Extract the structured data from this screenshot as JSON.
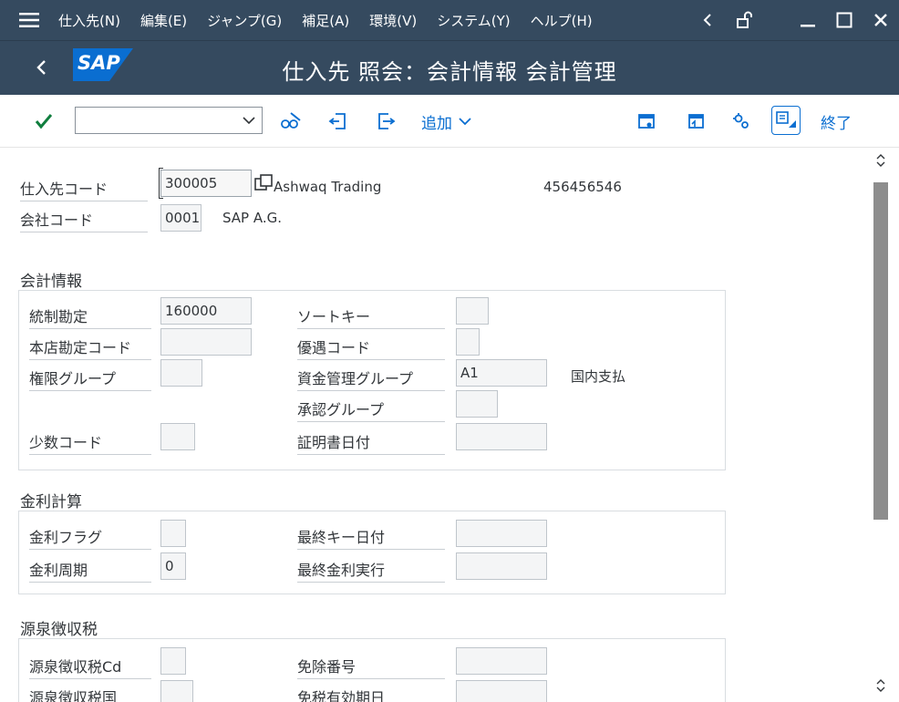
{
  "menubar": {
    "items": [
      "仕入先(N)",
      "編集(E)",
      "ジャンプ(G)",
      "補足(A)",
      "環境(V)",
      "システム(Y)",
      "ヘルプ(H)"
    ]
  },
  "titlebar": {
    "logo_text": "SAP",
    "title": "仕入先 照会：会計情報 会計管理"
  },
  "toolbar": {
    "command_placeholder": "",
    "add_label": "追加",
    "exit_label": "終了"
  },
  "header": {
    "vendor_label": "仕入先コード",
    "vendor_value": "300005",
    "vendor_name": "Ashwaq Trading",
    "vendor_number": "456456546",
    "company_label": "会社コード",
    "company_value": "0001",
    "company_name": "SAP A.G."
  },
  "accounting": {
    "title": "会計情報",
    "recon_label": "統制勘定",
    "recon_value": "160000",
    "sort_label": "ソートキー",
    "sort_value": "",
    "head_office_label": "本店勘定コード",
    "head_office_value": "",
    "preference_label": "優遇コード",
    "preference_value": "",
    "auth_label": "権限グループ",
    "auth_value": "",
    "cash_mgmt_label": "資金管理グループ",
    "cash_mgmt_value": "A1",
    "cash_mgmt_desc": "国内支払",
    "approval_label": "承認グループ",
    "approval_value": "",
    "minority_label": "少数コード",
    "minority_value": "",
    "cert_date_label": "証明書日付",
    "cert_date_value": ""
  },
  "interest": {
    "title": "金利計算",
    "flag_label": "金利フラグ",
    "flag_value": "",
    "last_key_date_label": "最終キー日付",
    "last_key_date_value": "",
    "cycle_label": "金利周期",
    "cycle_value": "0",
    "last_run_label": "最終金利実行",
    "last_run_value": ""
  },
  "withholding": {
    "title": "源泉徴収税",
    "code_label": "源泉徴収税Cd",
    "code_value": "",
    "exempt_no_label": "免除番号",
    "exempt_no_value": "",
    "country_label": "源泉徴収税国",
    "country_value": "",
    "valid_date_label": "免税有効期日",
    "valid_date_value": ""
  },
  "colors": {
    "shell": "#354a5f",
    "accent": "#0a6ed1",
    "logo": "#0a6ed1",
    "check": "#107e3e"
  }
}
